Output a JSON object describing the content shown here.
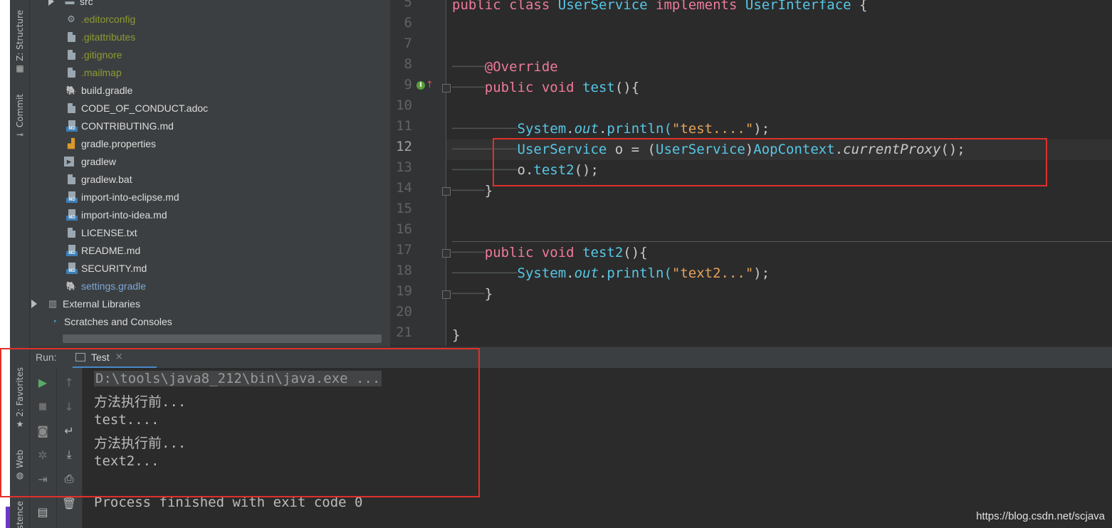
{
  "left_strip": {
    "structure_label": "Z: Structure",
    "commit_label": "Commit",
    "favorites_label": "2: Favorites",
    "web_label": "Web",
    "persistence_label": "stence"
  },
  "project_tree": {
    "items": [
      {
        "label": "src",
        "kind": "folder",
        "color": "normal"
      },
      {
        "label": ".editorconfig",
        "kind": "gear",
        "color": "olive"
      },
      {
        "label": ".gitattributes",
        "kind": "file",
        "color": "olive"
      },
      {
        "label": ".gitignore",
        "kind": "file",
        "color": "olive"
      },
      {
        "label": ".mailmap",
        "kind": "file",
        "color": "olive"
      },
      {
        "label": "build.gradle",
        "kind": "gradle",
        "color": "normal"
      },
      {
        "label": "CODE_OF_CONDUCT.adoc",
        "kind": "file",
        "color": "normal"
      },
      {
        "label": "CONTRIBUTING.md",
        "kind": "md",
        "color": "normal"
      },
      {
        "label": "gradle.properties",
        "kind": "props",
        "color": "normal"
      },
      {
        "label": "gradlew",
        "kind": "script",
        "color": "normal"
      },
      {
        "label": "gradlew.bat",
        "kind": "file",
        "color": "normal"
      },
      {
        "label": "import-into-eclipse.md",
        "kind": "md",
        "color": "normal"
      },
      {
        "label": "import-into-idea.md",
        "kind": "md",
        "color": "normal"
      },
      {
        "label": "LICENSE.txt",
        "kind": "file",
        "color": "normal"
      },
      {
        "label": "README.md",
        "kind": "md",
        "color": "normal"
      },
      {
        "label": "SECURITY.md",
        "kind": "md",
        "color": "normal"
      },
      {
        "label": "settings.gradle",
        "kind": "gradle",
        "color": "blueish"
      }
    ],
    "external_libraries": "External Libraries",
    "scratches": "Scratches and Consoles"
  },
  "editor": {
    "line_numbers": [
      "5",
      "6",
      "7",
      "8",
      "9",
      "10",
      "11",
      "12",
      "13",
      "14",
      "15",
      "16",
      "17",
      "18",
      "19",
      "20",
      "21"
    ],
    "current_line": "12",
    "code": {
      "l5": {
        "kw1": "public",
        "kw2": "class",
        "cls": "UserService",
        "kw3": "implements",
        "iface": "UserInterface",
        "brace": "{"
      },
      "l8": {
        "ann": "@Override"
      },
      "l9": {
        "kw1": "public",
        "kw2": "void",
        "name": "test",
        "rest": "(){"
      },
      "l11": {
        "obj": "System",
        "dot1": ".",
        "field": "out",
        "dot2": ".",
        "call": "println(",
        "str": "\"test....\"",
        "end": ");"
      },
      "l12": {
        "type": "UserService",
        "var": " o = (",
        "cast": "UserService",
        "close": ")",
        "cls": "AopContext",
        "dot": ".",
        "call": "currentProxy",
        "end": "();"
      },
      "l13": {
        "obj": "o.",
        "call": "test2",
        "end": "();"
      },
      "l14": {
        "brace": "}"
      },
      "l17": {
        "kw1": "public",
        "kw2": "void",
        "name": "test2",
        "rest": "(){"
      },
      "l18": {
        "obj": "System",
        "dot1": ".",
        "field": "out",
        "dot2": ".",
        "call": "println(",
        "str": "\"text2...\"",
        "end": ");"
      },
      "l19": {
        "brace": "}"
      },
      "l21": {
        "brace": "}"
      }
    }
  },
  "run": {
    "title": "Run:",
    "tab_label": "Test",
    "tab_close": "×",
    "console_lines": [
      "D:\\tools\\java8_212\\bin\\java.exe ...",
      "方法执行前...",
      "test....",
      "方法执行前...",
      "text2...",
      "",
      "Process finished with exit code 0"
    ]
  },
  "watermark": "https://blog.csdn.net/scjava",
  "colors": {
    "highlight_box": "#e0302a",
    "keyword": "#f07a9a",
    "class_ref": "#56c7e6",
    "string": "#e6a35c"
  }
}
